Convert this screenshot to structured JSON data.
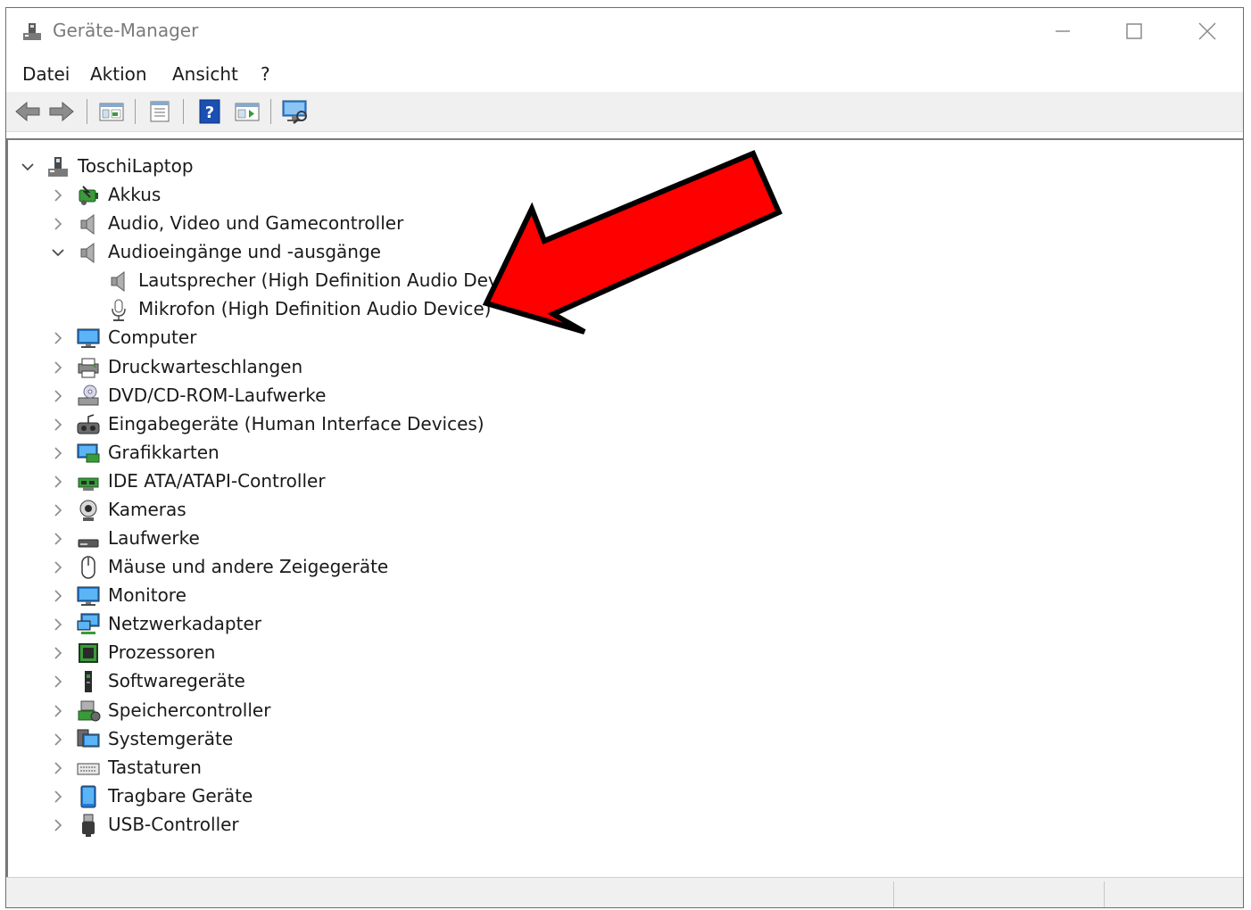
{
  "window": {
    "title": "Geräte-Manager",
    "accent": "#0078d7"
  },
  "menu": {
    "items": [
      "Datei",
      "Aktion",
      "Ansicht",
      "?"
    ]
  },
  "toolbar": {
    "buttons": [
      "back-icon",
      "forward-icon",
      "properties-icon",
      "update-driver-icon",
      "help-icon",
      "view-icon",
      "scan-hardware-icon"
    ]
  },
  "tree": {
    "root": {
      "label": "ToschiLaptop",
      "icon": "computer-root-icon",
      "expanded": true
    },
    "categories": [
      {
        "label": "Akkus",
        "icon": "battery-icon",
        "expanded": false
      },
      {
        "label": "Audio, Video und Gamecontroller",
        "icon": "speaker-icon",
        "expanded": false
      },
      {
        "label": "Audioeingänge und -ausgänge",
        "icon": "speaker-icon",
        "expanded": true,
        "children": [
          {
            "label": "Lautsprecher (High Definition Audio Device)",
            "icon": "speaker-icon"
          },
          {
            "label": "Mikrofon (High Definition Audio Device)",
            "icon": "microphone-icon"
          }
        ]
      },
      {
        "label": "Computer",
        "icon": "monitor-icon",
        "expanded": false
      },
      {
        "label": "Druckwarteschlangen",
        "icon": "printer-icon",
        "expanded": false
      },
      {
        "label": "DVD/CD-ROM-Laufwerke",
        "icon": "dvd-icon",
        "expanded": false
      },
      {
        "label": "Eingabegeräte (Human Interface Devices)",
        "icon": "hid-icon",
        "expanded": false
      },
      {
        "label": "Grafikkarten",
        "icon": "display-adapter-icon",
        "expanded": false
      },
      {
        "label": "IDE ATA/ATAPI-Controller",
        "icon": "ide-controller-icon",
        "expanded": false
      },
      {
        "label": "Kameras",
        "icon": "camera-icon",
        "expanded": false
      },
      {
        "label": "Laufwerke",
        "icon": "drive-icon",
        "expanded": false
      },
      {
        "label": "Mäuse und andere Zeigegeräte",
        "icon": "mouse-icon",
        "expanded": false
      },
      {
        "label": "Monitore",
        "icon": "monitor-icon",
        "expanded": false
      },
      {
        "label": "Netzwerkadapter",
        "icon": "network-icon",
        "expanded": false
      },
      {
        "label": "Prozessoren",
        "icon": "processor-icon",
        "expanded": false
      },
      {
        "label": "Softwaregeräte",
        "icon": "software-device-icon",
        "expanded": false
      },
      {
        "label": "Speichercontroller",
        "icon": "storage-controller-icon",
        "expanded": false
      },
      {
        "label": "Systemgeräte",
        "icon": "system-device-icon",
        "expanded": false
      },
      {
        "label": "Tastaturen",
        "icon": "keyboard-icon",
        "expanded": false
      },
      {
        "label": "Tragbare Geräte",
        "icon": "portable-device-icon",
        "expanded": false
      },
      {
        "label": "USB-Controller",
        "icon": "usb-icon",
        "expanded": false
      }
    ]
  },
  "annotation": {
    "color": "#ff0000",
    "target": "Mikrofon (High Definition Audio Device)"
  }
}
